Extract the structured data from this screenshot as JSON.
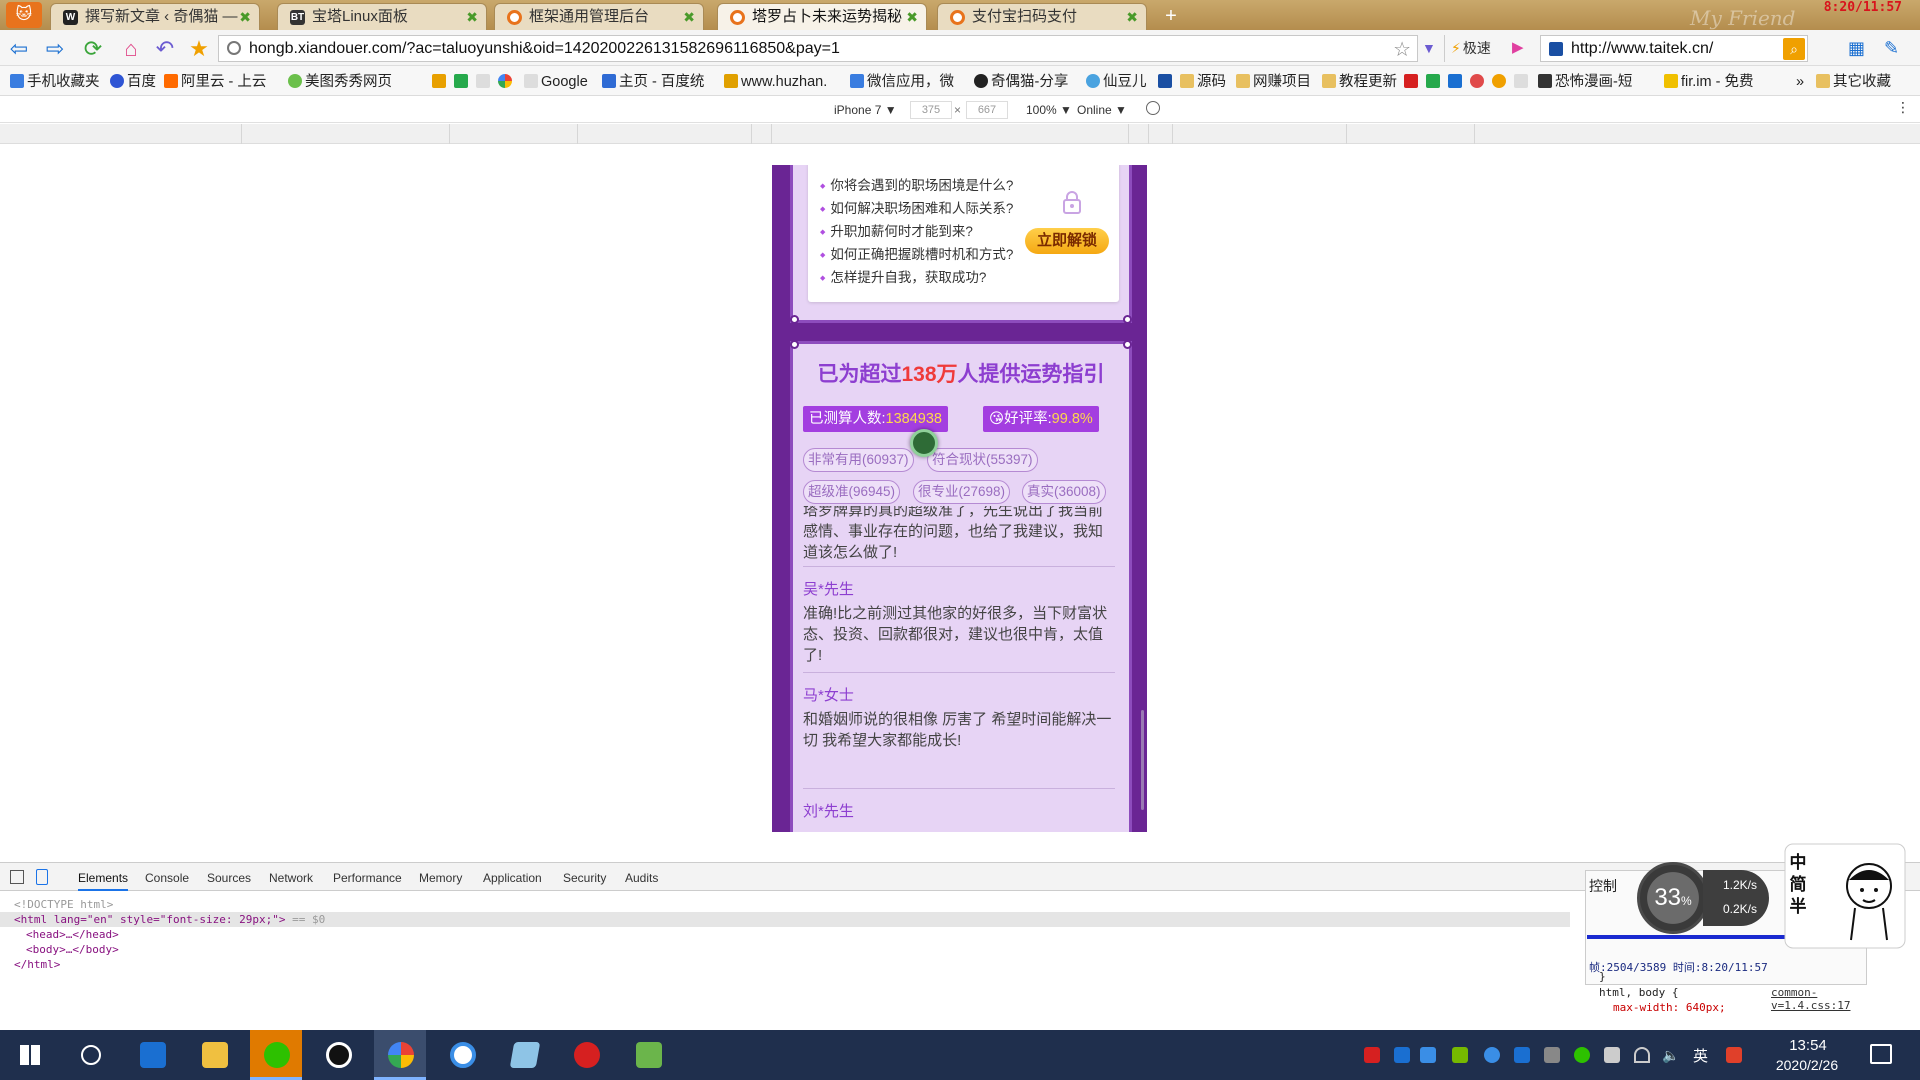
{
  "tabs": [
    {
      "title": "撰写新文章 ‹ 奇偶猫 — ",
      "active": false,
      "color": "#222222",
      "icon": "wordpress-icon"
    },
    {
      "title": "宝塔Linux面板",
      "active": false,
      "color": "#333333",
      "icon": "bt-icon",
      "glyph": "BT"
    },
    {
      "title": "框架通用管理后台",
      "active": false,
      "color": "#e8731c",
      "icon": "site-icon"
    },
    {
      "title": "塔罗占卜未来运势揭秘",
      "active": true,
      "color": "#e8731c",
      "icon": "site-icon"
    },
    {
      "title": "支付宝扫码支付",
      "active": false,
      "color": "#e8731c",
      "icon": "site-icon"
    }
  ],
  "titlebar": {
    "clock": "8:20/11:57",
    "deco_text": "My Friend"
  },
  "address": {
    "url": "hongb.xiandouer.com/?ac=taluoyunshi&oid=1420200226131582696116850&pay=1"
  },
  "engine": {
    "label": "极速"
  },
  "search": {
    "value": "http://www.taitek.cn/"
  },
  "bookmarks": [
    "手机收藏夹",
    "百度",
    "阿里云 - 上云",
    "美图秀秀网页",
    "Google",
    "主页 - 百度统",
    "www.huzhan.",
    "微信应用，微",
    "奇偶猫-分享",
    "仙豆儿",
    "源码",
    "网赚项目",
    "教程更新",
    "恐怖漫画-短",
    "fir.im - 免费",
    "»",
    "其它收藏"
  ],
  "device_toolbar": {
    "device": "iPhone 7 ▼",
    "width": "375",
    "times": "×",
    "height": "667",
    "zoom": "100% ▼",
    "network": "Online ▼"
  },
  "locked_card": {
    "questions": [
      "你将会遇到的职场困境是什么?",
      "如何解决职场困难和人际关系?",
      "升职加薪何时才能到来?",
      "如何正确把握跳槽时机和方式?",
      "怎样提升自我，获取成功?"
    ],
    "unlock_label": "立即解锁"
  },
  "stats": {
    "title_pre": "已为超过",
    "title_num": "138万",
    "title_post": "人提供运势指引",
    "count_label": "已测算人数:",
    "count_value": "1384938",
    "rating_label": "好评率:",
    "rating_value": "99.8%",
    "tags": [
      "非常有用(60937)",
      "符合现状(55397)",
      "超级准(96945)",
      "很专业(27698)",
      "真实(36008)"
    ]
  },
  "reviews": [
    {
      "author": "",
      "text": "塔罗牌算的真的超级准了，先生说出了我当前感情、事业存在的问题，也给了我建议，我知道该怎么做了!"
    },
    {
      "author": "吴*先生",
      "text": "准确!比之前测过其他家的好很多，当下财富状态、投资、回款都很对，建议也很中肯，太值了!"
    },
    {
      "author": "马*女士",
      "text": "和婚姻师说的很相像 厉害了 希望时间能解决一切 我希望大家都能成长!"
    },
    {
      "author": "刘*先生",
      "text": ""
    }
  ],
  "devtools": {
    "tabs": [
      "Elements",
      "Console",
      "Sources",
      "Network",
      "Performance",
      "Memory",
      "Application",
      "Security",
      "Audits"
    ],
    "dom": {
      "doctype": "<!DOCTYPE html>",
      "html_open": "<html lang=\"en\" style=\"font-size: 29px;\">",
      "html_open_suffix": " == $0",
      "head": "<head>…</head>",
      "body": "<body>…</body>",
      "html_close": "</html>"
    }
  },
  "monitor": {
    "title": "控制",
    "cpu": "33",
    "cpu_unit": "%",
    "net_up": "1.2K/s",
    "net_down": "0.2K/s",
    "footer": "帧:2504/3589 时间:8:20/11:57",
    "css_rule": "html, body {",
    "css_prop": "max-width: 640px;",
    "css_close": "}",
    "css_link": "common-v=1.4.css:17",
    "mascot_text": "中简半"
  },
  "taskbar": {
    "time": "13:54",
    "date": "2020/2/26",
    "lang": "英"
  },
  "colors": {
    "purple_bg": "#6a2594",
    "accent_purple": "#8d3ed0",
    "highlight_red": "#ef3a3a",
    "pill_bg": "#a33ee0",
    "pill_number": "#ffd84a",
    "unlock_gold": "#f5a812"
  }
}
